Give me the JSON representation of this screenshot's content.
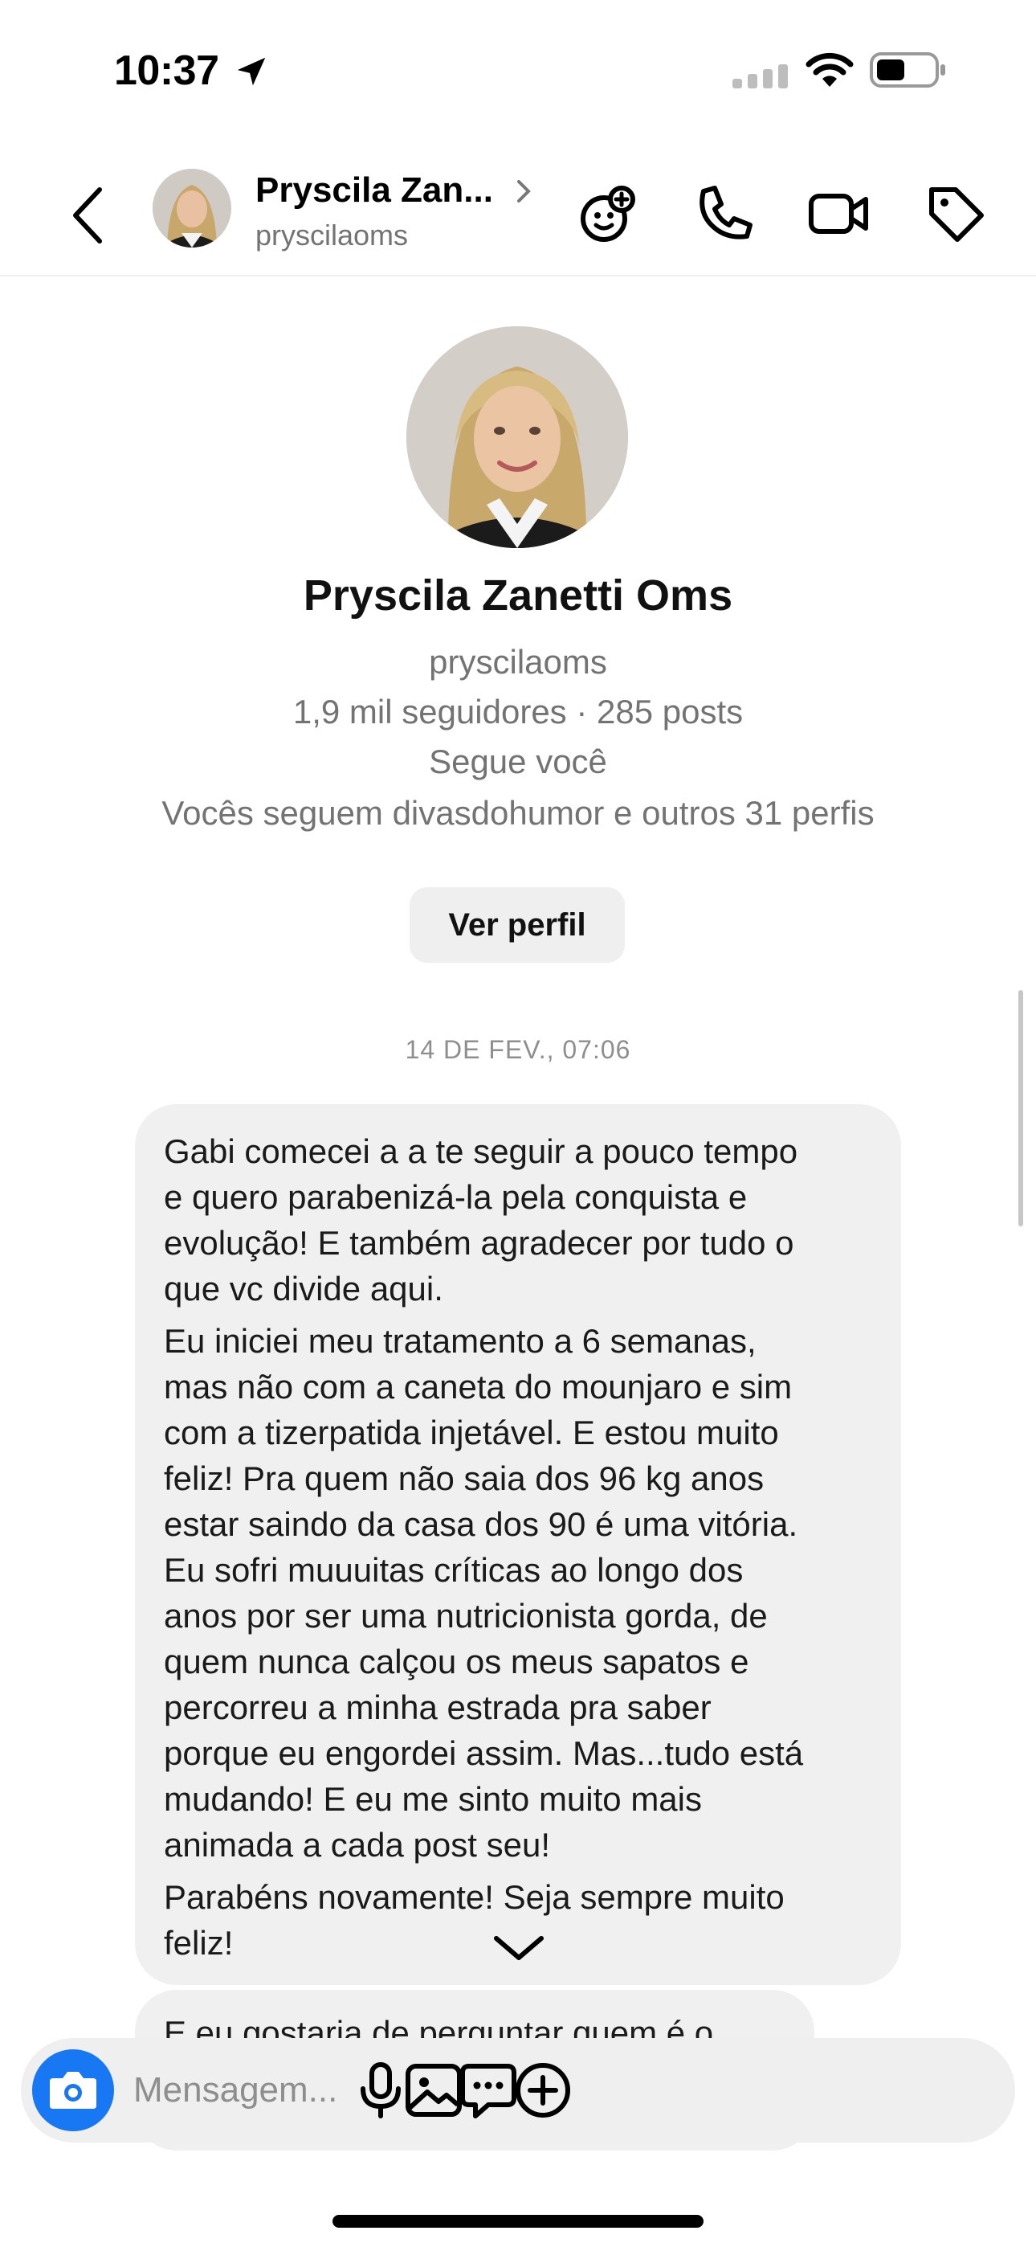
{
  "status_bar": {
    "time": "10:37"
  },
  "header": {
    "name": "Pryscila Zan...",
    "handle": "pryscilaoms",
    "icons": [
      "back-icon",
      "chevron-right-icon",
      "sticker-icon",
      "phone-icon",
      "video-icon",
      "tag-icon"
    ]
  },
  "profile": {
    "name": "Pryscila Zanetti Oms",
    "handle": "pryscilaoms",
    "stats": "1,9 mil seguidores · 285 posts",
    "follows_you": "Segue você",
    "mutuals": "Vocês seguem divasdohumor e outros 31 perfis",
    "view_profile_label": "Ver perfil"
  },
  "conversation": {
    "date_separator": "14 DE FEV., 07:06",
    "messages": [
      {
        "paragraphs": [
          "Gabi comecei a a te seguir a pouco tempo\ne quero parabenizá-la pela conquista e\nevolução! E também agradecer por tudo o\nque vc divide aqui.",
          "Eu iniciei meu tratamento a 6 semanas,\nmas não com a caneta do mounjaro e sim\ncom a tizerpatida injetável. E estou muito\nfeliz! Pra quem não saia dos 96 kg anos\nestar saindo da casa dos 90 é uma vitória.\nEu sofri muuuitas críticas  ao longo dos\nanos por ser uma nutricionista gorda, de\nquem nunca calçou os meus sapatos e\npercorreu a minha estrada pra saber\nporque eu engordei assim. Mas...tudo está\nmudando! E eu me sinto muito mais\nanimada a cada post seu!",
          "Parabéns novamente! Seja sempre muito\nfeliz!"
        ]
      },
      {
        "text": "E eu gostaria de perguntar quem é o"
      }
    ]
  },
  "composer": {
    "placeholder": "Mensagem...",
    "icons": [
      "camera-icon",
      "microphone-icon",
      "gallery-icon",
      "chat-bubble-icon",
      "plus-circle-icon"
    ]
  },
  "colors": {
    "accent": "#1877f2",
    "bubble_bg": "#f0f0f0",
    "secondary_text": "#737373"
  }
}
